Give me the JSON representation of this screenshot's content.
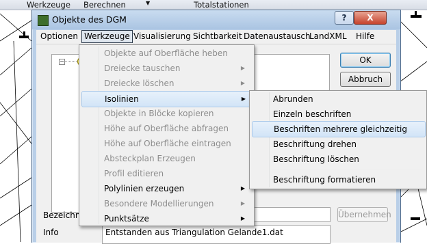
{
  "app_menu": {
    "items": [
      {
        "label": "Werkzeuge"
      },
      {
        "label": "Berechnen"
      },
      {
        "label": "Totalstationen"
      }
    ]
  },
  "dialog": {
    "title": "Objekte des DGM",
    "help_glyph": "?",
    "close_glyph": "X",
    "menu": [
      {
        "label": "Optionen"
      },
      {
        "label": "Werkzeuge"
      },
      {
        "label": "Visualisierung"
      },
      {
        "label": "Sichtbarkeit"
      },
      {
        "label": "Datenaustausch"
      },
      {
        "label": "LandXML"
      },
      {
        "label": "Hilfe"
      }
    ],
    "buttons": {
      "ok": "OK",
      "abbruch": "Abbruch",
      "uebernehmen": "Übernehmen"
    },
    "fields": {
      "bezeichnung_label": "Bezeichnur",
      "info_label": "Info",
      "info_value": "Entstanden aus Triangulation Gelande1.dat"
    }
  },
  "werkzeuge_menu": [
    {
      "label": "Objekte auf Oberfläche heben",
      "enabled": false,
      "submenu": false
    },
    {
      "label": "Dreiecke tauschen",
      "enabled": false,
      "submenu": true
    },
    {
      "label": "Dreiecke löschen",
      "enabled": false,
      "submenu": true
    },
    {
      "label": "Isolinien",
      "enabled": true,
      "submenu": true,
      "highlighted": true
    },
    {
      "label": "Objekte in Blöcke kopieren",
      "enabled": false,
      "submenu": false
    },
    {
      "label": "Höhe auf Oberfläche abfragen",
      "enabled": false,
      "submenu": false
    },
    {
      "label": "Höhe auf Oberfläche eintragen",
      "enabled": false,
      "submenu": false
    },
    {
      "label": "Absteckplan Erzeugen",
      "enabled": false,
      "submenu": false
    },
    {
      "label": "Profil editieren",
      "enabled": false,
      "submenu": false
    },
    {
      "label": "Polylinien erzeugen",
      "enabled": true,
      "submenu": true
    },
    {
      "label": "Besondere Modellierungen",
      "enabled": false,
      "submenu": true
    },
    {
      "label": "Punktsätze",
      "enabled": true,
      "submenu": true
    }
  ],
  "isolinien_submenu": [
    {
      "label": "Abrunden"
    },
    {
      "label": "Einzeln beschriften"
    },
    {
      "label": "Beschriften mehrere gleichzeitig",
      "highlighted": true
    },
    {
      "label": "Beschriftung drehen"
    },
    {
      "label": "Beschriftung löschen"
    },
    {
      "label": "Beschriftung formatieren"
    }
  ]
}
